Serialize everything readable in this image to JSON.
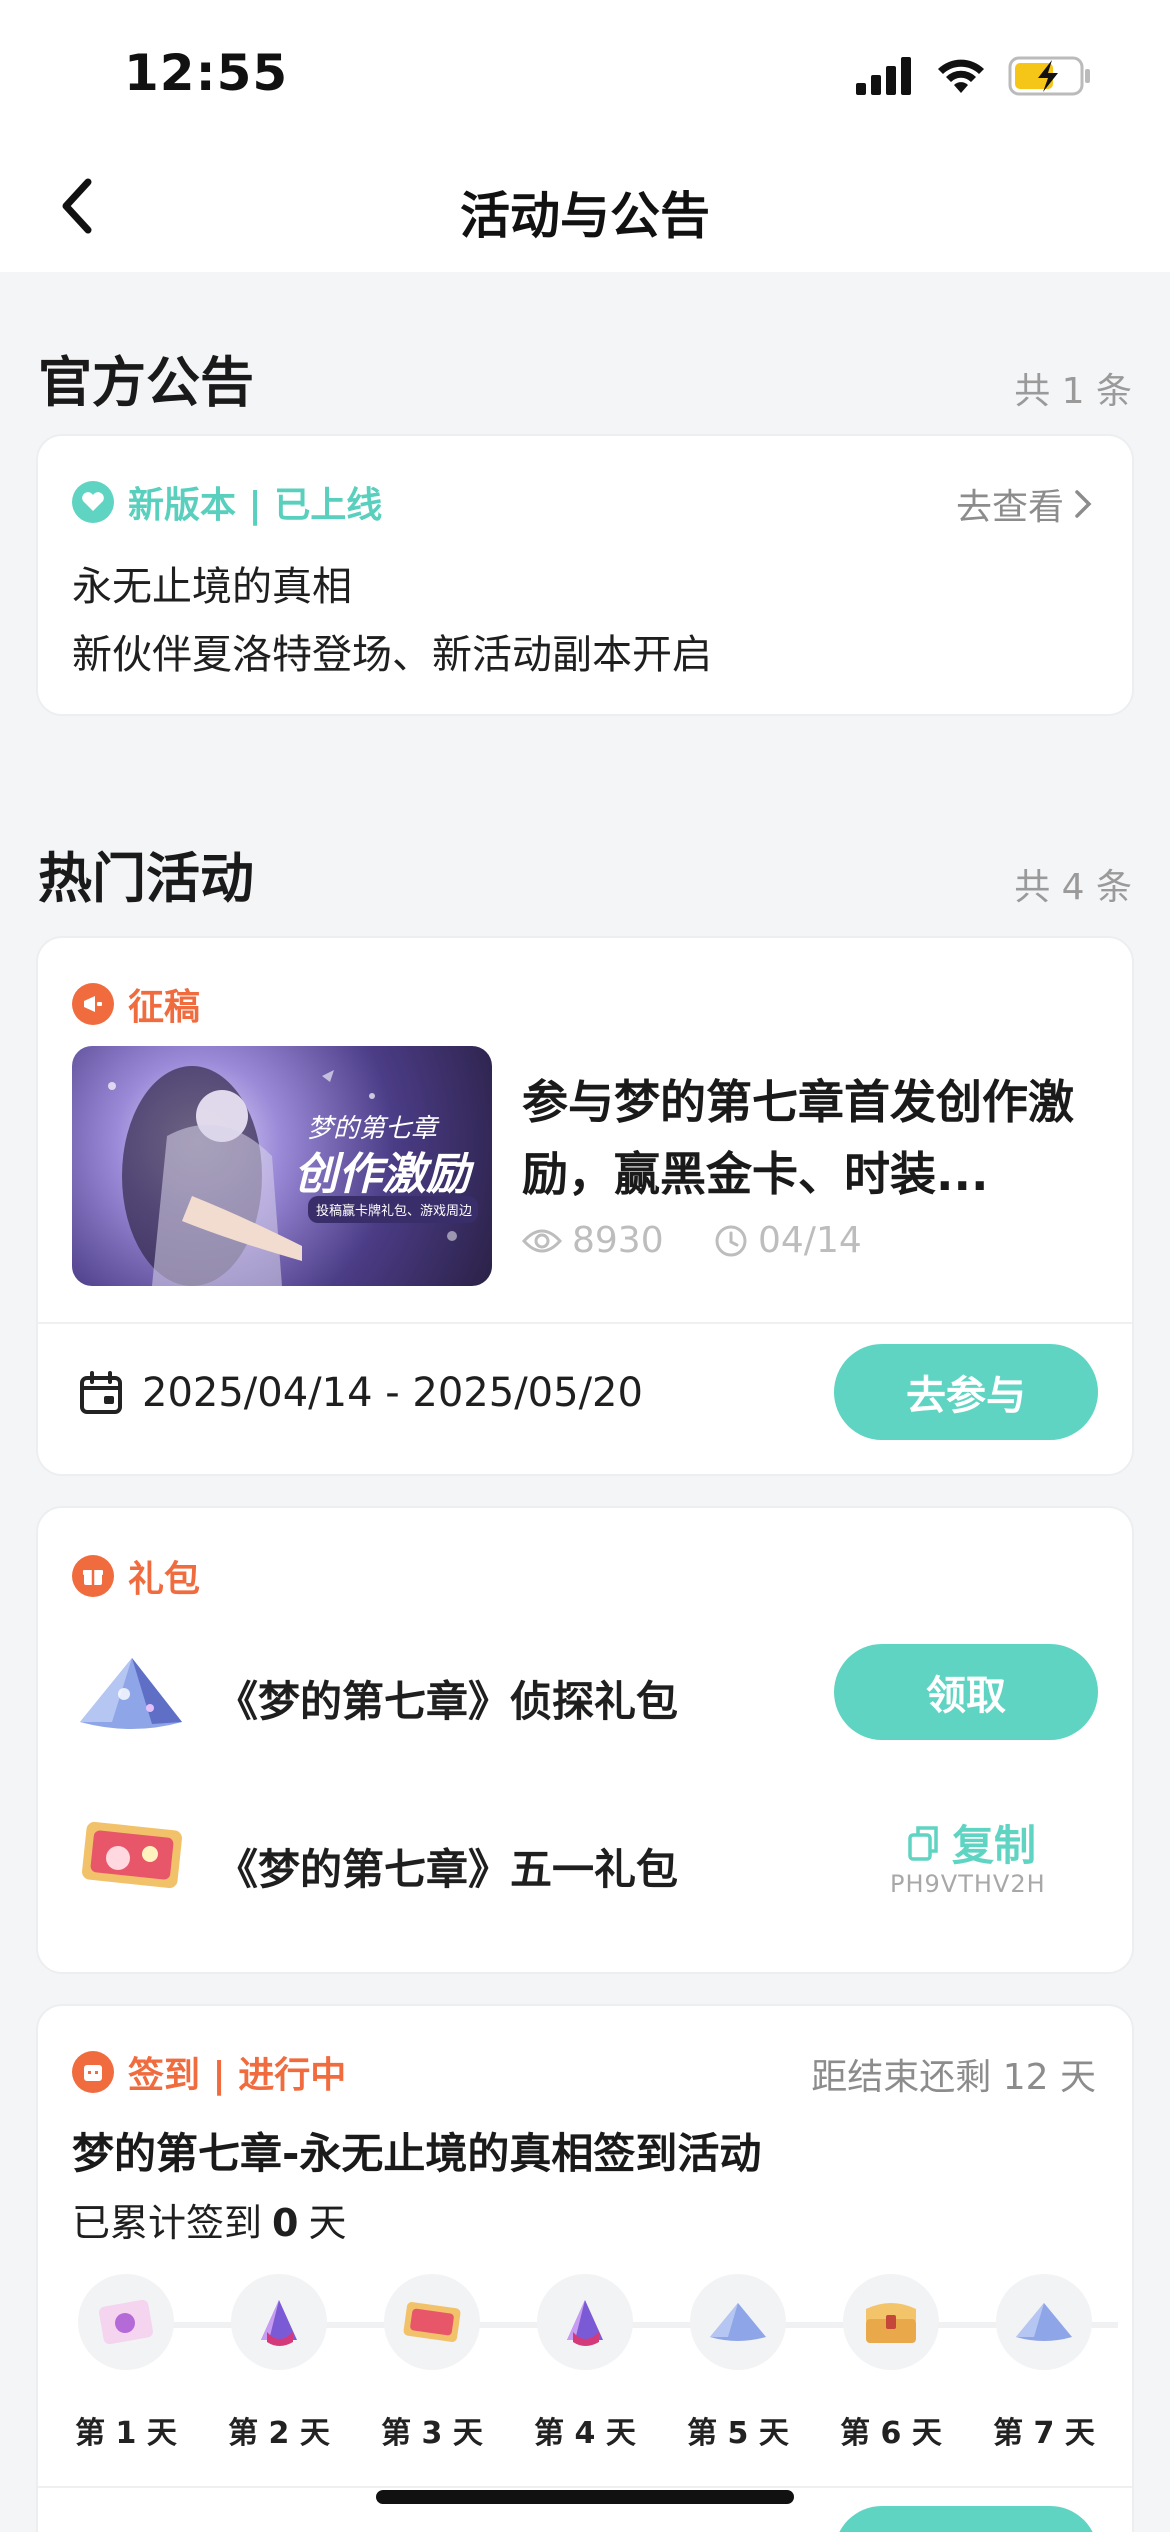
{
  "status": {
    "time": "12:55"
  },
  "nav": {
    "title": "活动与公告"
  },
  "announcements": {
    "title": "官方公告",
    "count": "共 1 条",
    "card": {
      "tag": "新版本 | 已上线",
      "link": "去查看",
      "line1": "永无止境的真相",
      "line2": "新伙伴夏洛特登场、新活动副本开启"
    }
  },
  "hot": {
    "title": "热门活动",
    "count": "共 4 条",
    "submission": {
      "tag": "征稿",
      "banner_title": "梦的第七章",
      "banner_big": "创作激励",
      "banner_sub": "投稿赢卡牌礼包、游戏周边",
      "headline": "参与梦的第七章首发创作激励，赢黑金卡、时装...",
      "views": "8930",
      "date": "04/14",
      "range": "2025/04/14 - 2025/05/20",
      "button": "去参与"
    },
    "gift": {
      "tag": "礼包",
      "items": [
        {
          "name": "《梦的第七章》侦探礼包",
          "action": "领取"
        },
        {
          "name": "《梦的第七章》五一礼包",
          "action": "复制",
          "code": "PH9VTHV2H"
        }
      ]
    },
    "checkin": {
      "tag": "签到 | 进行中",
      "remaining": "距结束还剩 12 天",
      "title": "梦的第七章-永无止境的真相签到活动",
      "progress_prefix": "已累计签到",
      "progress_days": "0",
      "progress_suffix": "天",
      "days": [
        "第 1 天",
        "第 2 天",
        "第 3 天",
        "第 4 天",
        "第 5 天",
        "第 6 天",
        "第 7 天"
      ],
      "icons": [
        "card-icon",
        "crystal-icon",
        "ticket-icon",
        "crystal-icon",
        "pyramid-icon",
        "chest-icon",
        "pyramid-icon"
      ]
    }
  }
}
